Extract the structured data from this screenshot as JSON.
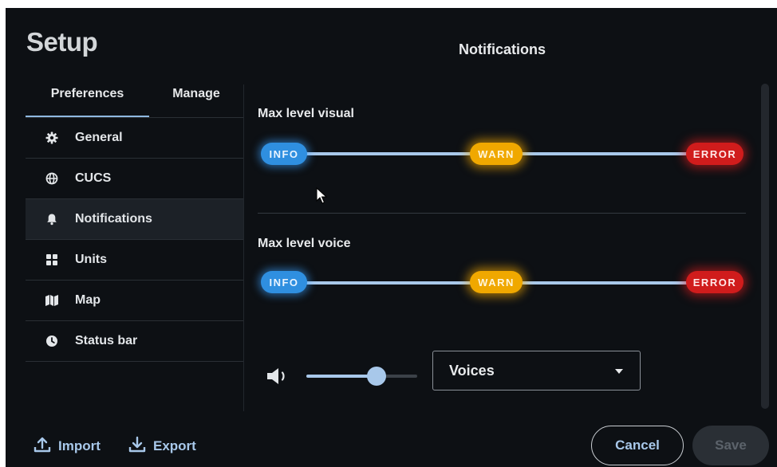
{
  "window": {
    "title": "Setup",
    "section_title": "Notifications"
  },
  "tabs": [
    {
      "label": "Preferences",
      "active": true
    },
    {
      "label": "Manage",
      "active": false
    }
  ],
  "sidebar": {
    "items": [
      {
        "label": "General",
        "icon": "gear-icon",
        "active": false
      },
      {
        "label": "CUCS",
        "icon": "globe-icon",
        "active": false
      },
      {
        "label": "Notifications",
        "icon": "bell-icon",
        "active": true
      },
      {
        "label": "Units",
        "icon": "grid-icon",
        "active": false
      },
      {
        "label": "Map",
        "icon": "map-icon",
        "active": false
      },
      {
        "label": "Status bar",
        "icon": "clock-icon",
        "active": false
      }
    ]
  },
  "notifications": {
    "visual": {
      "label": "Max level visual",
      "levels": [
        "INFO",
        "WARN",
        "ERROR"
      ]
    },
    "voice": {
      "label": "Max level voice",
      "levels": [
        "INFO",
        "WARN",
        "ERROR"
      ]
    },
    "volume": {
      "icon": "volume-icon",
      "level_fraction": 0.63
    },
    "voice_select": {
      "value": "Voices"
    }
  },
  "footer": {
    "import_label": "Import",
    "export_label": "Export",
    "cancel_label": "Cancel",
    "save_label": "Save"
  },
  "colors": {
    "background": "#0d1014",
    "accent": "#a8c8ea",
    "info": "#2f8fe0",
    "warn": "#f0a800",
    "error": "#d01c1c"
  }
}
